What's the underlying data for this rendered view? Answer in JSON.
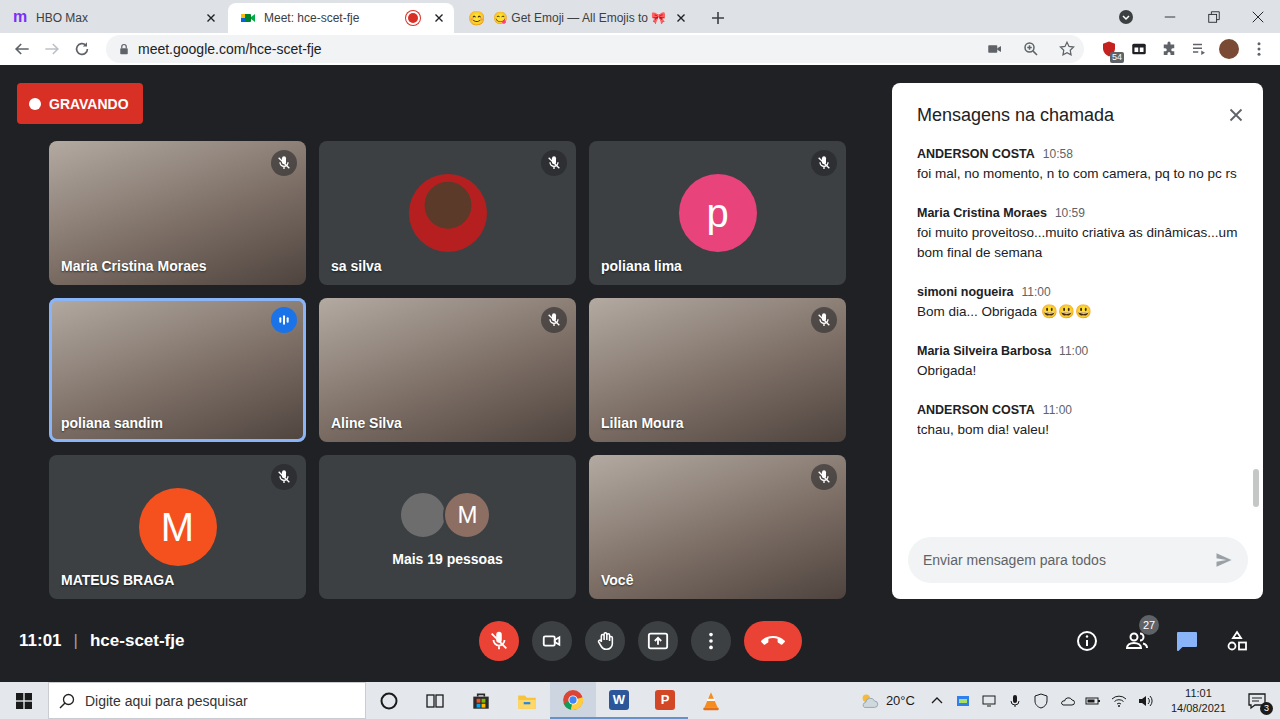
{
  "browser": {
    "tabs": [
      {
        "kind": "letter",
        "favicon": "m",
        "title": "HBO Max",
        "selected": false,
        "recording": false
      },
      {
        "kind": "meet",
        "favicon": "",
        "title": "Meet: hce-scet-fje",
        "selected": true,
        "recording": true
      },
      {
        "kind": "emoji",
        "favicon": "😊",
        "title": "😋 Get Emoji — All Emojis to 🎀",
        "selected": false,
        "recording": false
      }
    ],
    "address": "meet.google.com/hce-scet-fje",
    "extension_badge": "54"
  },
  "meet": {
    "recording_label": "GRAVANDO",
    "tiles": [
      {
        "name": "Maria Cristina Moraes",
        "kind": "video",
        "muted": true,
        "speaking": false
      },
      {
        "name": "sa silva",
        "kind": "photo-avatar",
        "muted": true,
        "speaking": false
      },
      {
        "name": "poliana lima",
        "kind": "letter-avatar",
        "initial": "p",
        "color": "#e8437a",
        "muted": true,
        "speaking": false
      },
      {
        "name": "poliana sandim",
        "kind": "video",
        "muted": false,
        "speaking": true
      },
      {
        "name": "Aline Silva",
        "kind": "video",
        "muted": true,
        "speaking": false
      },
      {
        "name": "Lilian Moura",
        "kind": "video",
        "muted": true,
        "speaking": false
      },
      {
        "name": "MATEUS BRAGA",
        "kind": "letter-avatar",
        "initial": "M",
        "color": "#f4511e",
        "muted": true,
        "speaking": false
      },
      {
        "name": "Mais 19 pessoas",
        "kind": "overflow",
        "avatars": [
          {
            "kind": "photo",
            "initial": "",
            "color": "#6d6d6d"
          },
          {
            "kind": "letter",
            "initial": "M",
            "color": "#8d6e63"
          }
        ],
        "muted": false,
        "speaking": false
      },
      {
        "name": "Você",
        "kind": "video",
        "muted": true,
        "speaking": false
      }
    ],
    "chat": {
      "title": "Mensagens na chamada",
      "messages": [
        {
          "author": "ANDERSON COSTA",
          "time": "10:58",
          "text": "foi mal, no momento, n to com camera, pq to no pc rs"
        },
        {
          "author": "Maria Cristina Moraes",
          "time": "10:59",
          "text": "foi muito proveitoso...muito criativa as dinâmicas...um bom final de semana"
        },
        {
          "author": "simoni nogueira",
          "time": "11:00",
          "text": "Bom dia... Obrigada 😃😃😃"
        },
        {
          "author": "Maria Silveira Barbosa",
          "time": "11:00",
          "text": "Obrigada!"
        },
        {
          "author": "ANDERSON COSTA",
          "time": "11:00",
          "text": "tchau, bom dia! valeu!"
        }
      ],
      "input_placeholder": "Enviar mensagem para todos"
    },
    "time": "11:01",
    "separator": "|",
    "meeting_code": "hce-scet-fje",
    "controls": {
      "mic_on": false,
      "camera_on": true,
      "chat_open": true
    },
    "participants_count": "27"
  },
  "taskbar": {
    "search_placeholder": "Digite aqui para pesquisar",
    "apps": [
      {
        "kind": "cortana",
        "running": false,
        "active": false
      },
      {
        "kind": "task-view",
        "running": false,
        "active": false
      },
      {
        "kind": "store",
        "running": false,
        "active": false
      },
      {
        "kind": "explorer",
        "running": false,
        "active": false
      },
      {
        "kind": "chrome",
        "running": true,
        "active": true
      },
      {
        "kind": "word",
        "letter": "W",
        "running": true,
        "active": false
      },
      {
        "kind": "powerpoint",
        "letter": "P",
        "running": true,
        "active": false
      },
      {
        "kind": "vlc",
        "running": false,
        "active": false
      }
    ],
    "weather": "20°C",
    "time": "11:01",
    "date": "14/08/2021",
    "notifications": "3"
  }
}
